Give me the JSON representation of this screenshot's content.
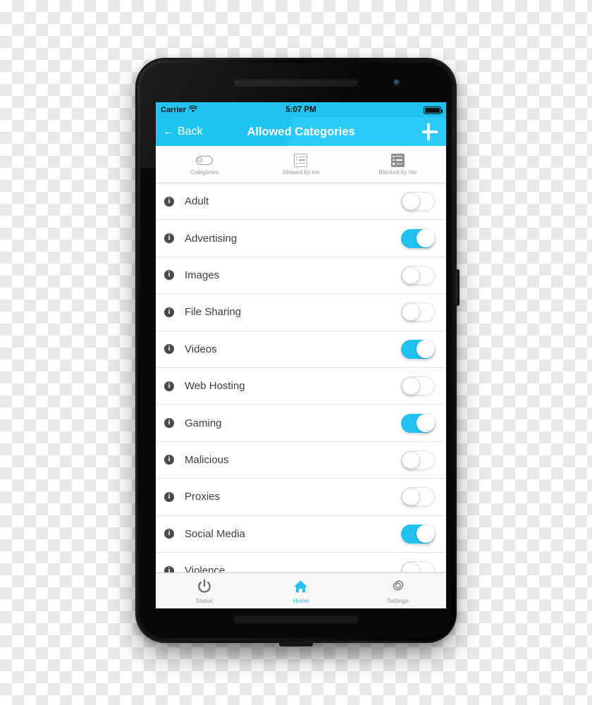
{
  "status_bar": {
    "carrier": "Carrier",
    "wifi_icon": "wifi-icon",
    "time": "5:07 PM",
    "battery_icon": "battery-full-icon"
  },
  "nav_bar": {
    "back_arrow_icon": "arrow-left-icon",
    "back_label": "Back",
    "title": "Allowed Categories",
    "add_icon": "plus-icon"
  },
  "segments": [
    {
      "label": "Categories",
      "icon": "toggle-switch-icon",
      "selected": true
    },
    {
      "label": "Allowed by me",
      "icon": "list-outline-icon",
      "selected": false
    },
    {
      "label": "Blocked by me",
      "icon": "list-filled-icon",
      "selected": false
    }
  ],
  "categories": [
    {
      "label": "Adult",
      "enabled": false,
      "info_icon": "info-icon"
    },
    {
      "label": "Advertising",
      "enabled": true,
      "info_icon": "info-icon"
    },
    {
      "label": "Images",
      "enabled": false,
      "info_icon": "info-icon"
    },
    {
      "label": "File Sharing",
      "enabled": false,
      "info_icon": "info-icon"
    },
    {
      "label": "Videos",
      "enabled": true,
      "info_icon": "info-icon"
    },
    {
      "label": "Web Hosting",
      "enabled": false,
      "info_icon": "info-icon"
    },
    {
      "label": "Gaming",
      "enabled": true,
      "info_icon": "info-icon"
    },
    {
      "label": "Malicious",
      "enabled": false,
      "info_icon": "info-icon"
    },
    {
      "label": "Proxies",
      "enabled": false,
      "info_icon": "info-icon"
    },
    {
      "label": "Social Media",
      "enabled": true,
      "info_icon": "info-icon"
    },
    {
      "label": "Violence",
      "enabled": false,
      "info_icon": "info-icon"
    }
  ],
  "tab_bar": [
    {
      "label": "Status",
      "icon": "power-icon",
      "active": false
    },
    {
      "label": "Home",
      "icon": "home-icon",
      "active": true
    },
    {
      "label": "Settings",
      "icon": "gear-icon",
      "active": false
    }
  ],
  "colors": {
    "accent": "#22c2f0",
    "nav_bar": "#1ec3f2",
    "row_text": "#3e3e3e",
    "muted_text": "#9a9a9a"
  }
}
